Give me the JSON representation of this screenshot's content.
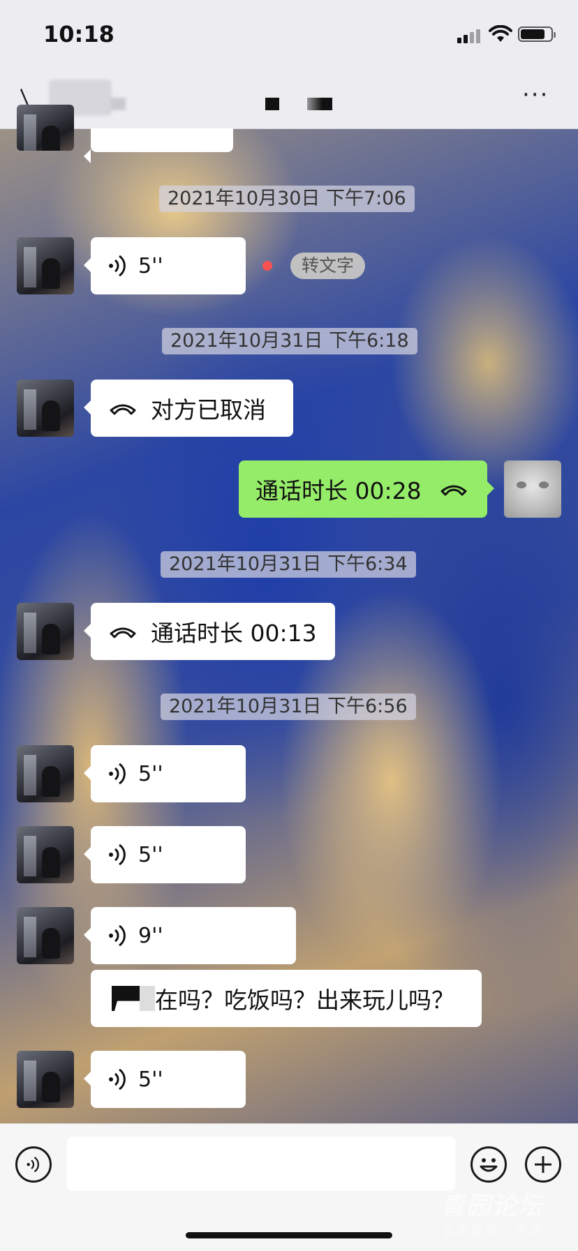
{
  "status_bar": {
    "time": "10:18"
  },
  "nav": {
    "more_label": "···"
  },
  "messages": {
    "ts1": "2021年10月30日 下午7:06",
    "voice1": "5''",
    "convert_label": "转文字",
    "ts2": "2021年10月31日 下午6:18",
    "call_cancelled": "对方已取消",
    "call_duration_self": "通话时长 00:28",
    "ts3": "2021年10月31日 下午6:34",
    "call_duration_other": "通话时长 00:13",
    "ts4": "2021年10月31日 下午6:56",
    "voice2": "5''",
    "voice3": "5''",
    "voice4": "9''",
    "transcript": "在吗？吃饭吗？出来玩儿吗？",
    "voice5": "5''"
  },
  "watermark": {
    "main": "青园论坛",
    "sub": "信息查询 · 生活"
  },
  "colors": {
    "self_bubble": "#95ec69",
    "other_bubble": "#ffffff",
    "unread_dot": "#fa5151"
  },
  "icons": [
    "voice-icon",
    "phone-icon",
    "emoji-icon",
    "plus-icon",
    "back-icon",
    "more-icon"
  ]
}
